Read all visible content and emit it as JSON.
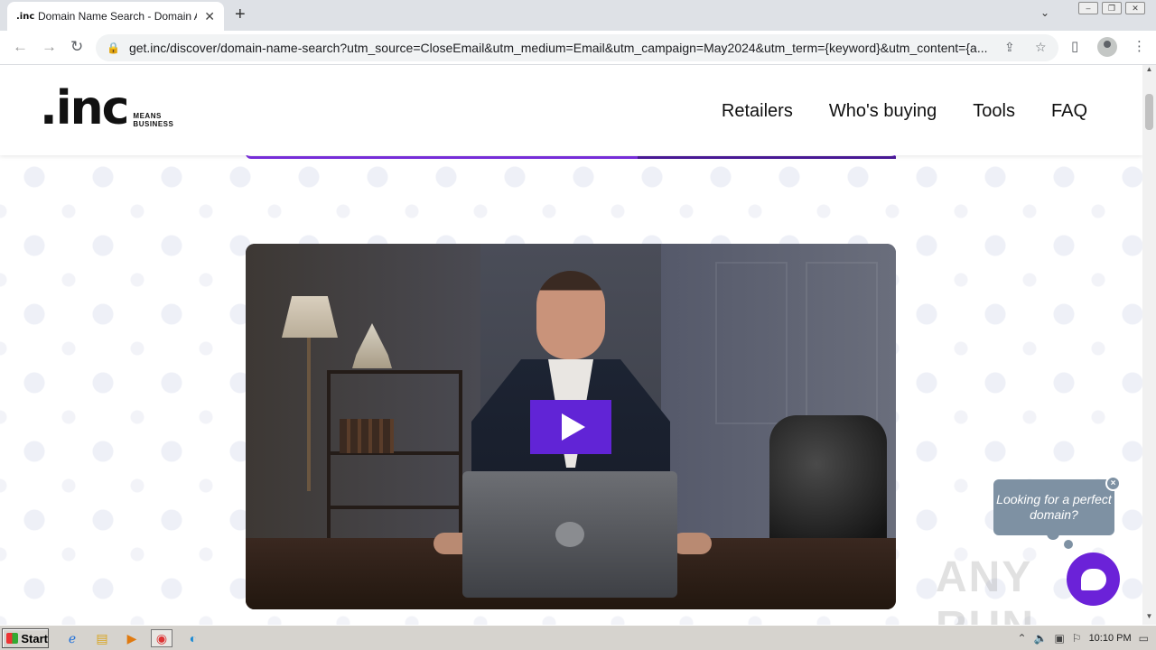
{
  "browser": {
    "tab_title": "Domain Name Search - Domain Avail",
    "tab_favicon": ".inc",
    "url": "get.inc/discover/domain-name-search?utm_source=CloseEmail&utm_medium=Email&utm_campaign=May2024&utm_term={keyword}&utm_content={a...",
    "icons": {
      "new_tab": "+",
      "tab_close": "✕",
      "back": "←",
      "forward": "→",
      "reload": "↻",
      "lock": "🔒",
      "share": "⇪",
      "bookmark": "☆",
      "side_panel": "▯",
      "menu": "⋮",
      "tab_list": "⌄",
      "minimize": "–",
      "restore": "❐",
      "close": "✕"
    }
  },
  "site": {
    "logo_text": ".inc",
    "logo_tagline_1": "MEANS",
    "logo_tagline_2": "BUSINESS",
    "nav": [
      "Retailers",
      "Who's buying",
      "Tools",
      "FAQ"
    ]
  },
  "chat": {
    "prompt": "Looking for a perfect domain?",
    "close": "×"
  },
  "watermark": "ANY RUN",
  "taskbar": {
    "start_label": "Start",
    "clock": "10:10 PM",
    "apps": [
      "ie-icon",
      "folder-icon",
      "media-player-icon",
      "chrome-icon",
      "edge-icon"
    ]
  },
  "colors": {
    "accent_purple": "#6124d6",
    "chat_bubble": "#7e91a3"
  }
}
